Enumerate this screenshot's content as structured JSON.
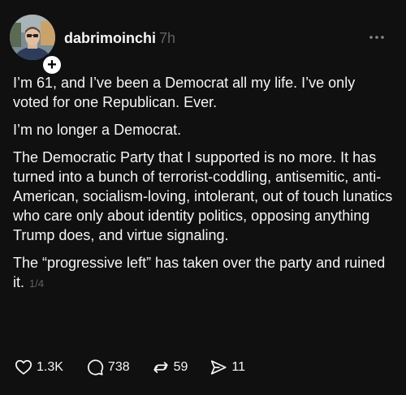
{
  "post": {
    "author": {
      "username": "dabrimoinchi",
      "time_ago": "7h"
    },
    "paragraphs": [
      "I’m 61, and I’ve been a Democrat all my life. I’ve only voted for one Republican. Ever.",
      "I’m no longer a Democrat.",
      "The Democratic Party that I supported is no more. It has turned into a bunch of terrorist-coddling, antisemitic, anti-American, socialism-loving, intolerant, out of touch lunatics who care only about identity politics, opposing anything Trump does, and virtue signaling."
    ],
    "last_paragraph": "The “progressive left” has taken over the party and ruined it.",
    "page_indicator": "1/4",
    "follow_badge": "+",
    "more_icon": "more-horizontal-icon",
    "stats": {
      "likes": "1.3K",
      "replies": "738",
      "reposts": "59",
      "shares": "11"
    },
    "icons": {
      "like": "heart-icon",
      "reply": "comment-icon",
      "repost": "repost-icon",
      "share": "send-icon"
    }
  },
  "colors": {
    "background": "#101010",
    "text": "#f3f5f7",
    "muted": "#616161"
  }
}
